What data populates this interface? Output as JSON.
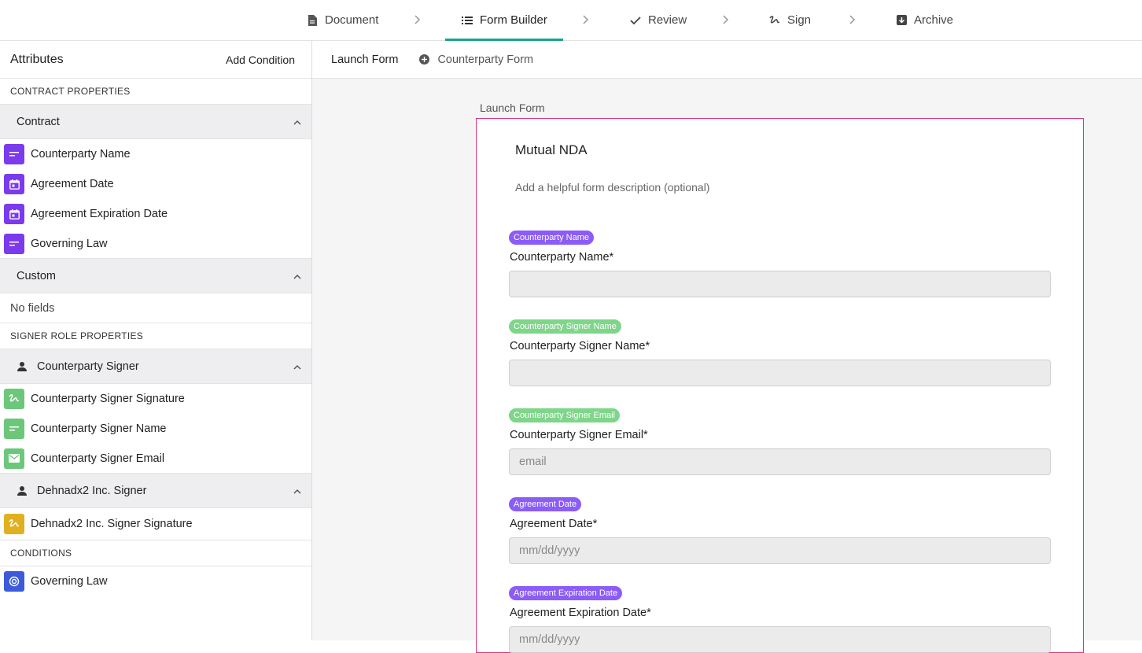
{
  "steps": [
    {
      "label": "Document",
      "icon": "document-icon"
    },
    {
      "label": "Form Builder",
      "icon": "list-icon",
      "active": true
    },
    {
      "label": "Review",
      "icon": "check-icon"
    },
    {
      "label": "Sign",
      "icon": "signature-icon"
    },
    {
      "label": "Archive",
      "icon": "archive-icon"
    }
  ],
  "sidebar": {
    "title": "Attributes",
    "add_condition": "Add Condition",
    "contract_properties": "CONTRACT PROPERTIES",
    "contract_group": "Contract",
    "contract_items": [
      {
        "label": "Counterparty Name",
        "icon": "text-field-icon",
        "color": "#7c3aed"
      },
      {
        "label": "Agreement Date",
        "icon": "calendar-icon",
        "color": "#7c3aed"
      },
      {
        "label": "Agreement Expiration Date",
        "icon": "calendar-icon",
        "color": "#7c3aed"
      },
      {
        "label": "Governing Law",
        "icon": "text-field-icon",
        "color": "#7c3aed"
      }
    ],
    "custom_group": "Custom",
    "no_fields": "No fields",
    "signer_role_properties": "SIGNER ROLE PROPERTIES",
    "counterparty_signer_group": "Counterparty Signer",
    "counterparty_signer_items": [
      {
        "label": "Counterparty Signer Signature",
        "icon": "signature-icon",
        "color": "#6cc77b"
      },
      {
        "label": "Counterparty Signer Name",
        "icon": "text-field-icon",
        "color": "#6cc77b"
      },
      {
        "label": "Counterparty Signer Email",
        "icon": "email-icon",
        "color": "#6cc77b"
      }
    ],
    "dehnadx_signer_group": "Dehnadx2 Inc. Signer",
    "dehnadx_signer_items": [
      {
        "label": "Dehnadx2 Inc. Signer Signature",
        "icon": "signature-icon",
        "color": "#e0b020"
      }
    ],
    "conditions": "CONDITIONS",
    "condition_items": [
      {
        "label": "Governing Law",
        "icon": "condition-icon",
        "color": "#3b5bdb"
      }
    ]
  },
  "main": {
    "tab_launch": "Launch Form",
    "tab_counterparty": "Counterparty Form",
    "form_caption": "Launch Form",
    "form_title": "Mutual NDA",
    "form_description": "Add a helpful form description (optional)",
    "fields": [
      {
        "tag": "Counterparty Name",
        "tag_color": "purple",
        "label": "Counterparty Name*",
        "placeholder": ""
      },
      {
        "tag": "Counterparty Signer Name",
        "tag_color": "green",
        "label": "Counterparty Signer Name*",
        "placeholder": ""
      },
      {
        "tag": "Counterparty Signer Email",
        "tag_color": "green",
        "label": "Counterparty Signer Email*",
        "placeholder": "email"
      },
      {
        "tag": "Agreement Date",
        "tag_color": "purple",
        "label": "Agreement Date*",
        "placeholder": "mm/dd/yyyy"
      },
      {
        "tag": "Agreement Expiration Date",
        "tag_color": "purple",
        "label": "Agreement Expiration Date*",
        "placeholder": "mm/dd/yyyy"
      }
    ]
  }
}
